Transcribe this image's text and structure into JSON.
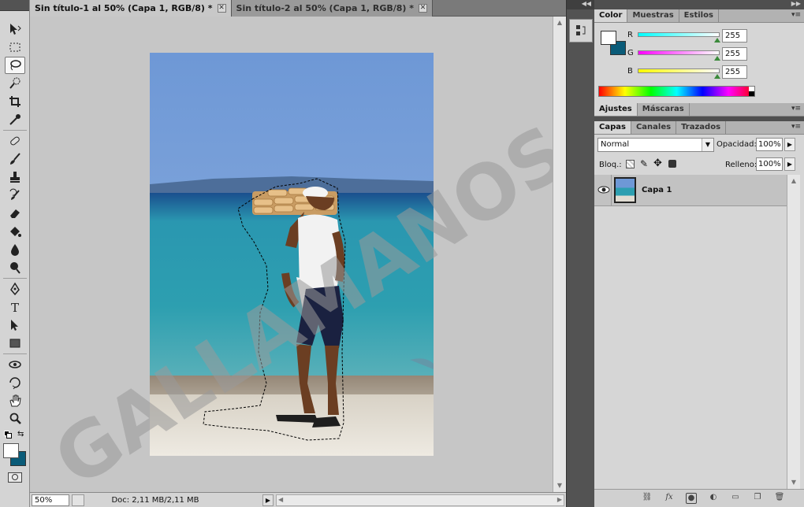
{
  "tabs": [
    {
      "label": "Sin título-1 al 50% (Capa 1, RGB/8) *",
      "active": true
    },
    {
      "label": "Sin título-2 al 50% (Capa 1, RGB/8) *",
      "active": false
    }
  ],
  "statusbar": {
    "zoom": "50%",
    "docinfo": "Doc: 2,11 MB/2,11 MB"
  },
  "watermark": "GALLAMANOS",
  "colorpanel": {
    "tabs": [
      "Color",
      "Muestras",
      "Estilos"
    ],
    "r_label": "R",
    "g_label": "G",
    "b_label": "B",
    "r": "255",
    "g": "255",
    "b": "255",
    "foreground": "#ffffff",
    "background": "#0a5b78"
  },
  "adjust": {
    "tabs": [
      "Ajustes",
      "Máscaras"
    ]
  },
  "layers": {
    "tabs": [
      "Capas",
      "Canales",
      "Trazados"
    ],
    "blend_mode": "Normal",
    "opacity_label": "Opacidad:",
    "opacity": "100%",
    "lock_label": "Bloq.:",
    "fill_label": "Relleno:",
    "fill": "100%",
    "layer_name": "Capa 1"
  },
  "colors": {
    "accent": "#0a5b78"
  }
}
